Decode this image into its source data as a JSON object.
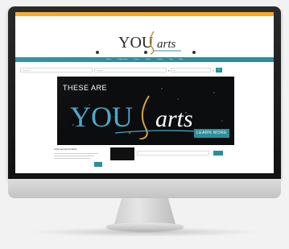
{
  "topbar": {
    "left": "",
    "right": "",
    "color": "#f6a623"
  },
  "logo": {
    "you": "YOU",
    "arts": "arts"
  },
  "nav": {
    "items": [
      "Home",
      "Creative Team",
      "Events",
      "Gallery",
      "Contact",
      "Shop",
      "Blog"
    ],
    "color": "#2a8f9a"
  },
  "search": {
    "field1": "Keywords",
    "field2": "Location",
    "field3": "All",
    "button": "Go"
  },
  "hero": {
    "top_text": "THESE ARE",
    "you": "YOU",
    "arts": "arts",
    "button": "LEARN MORE"
  },
  "lower": {
    "card_title": "4 Recommend Cards",
    "thumb_text": "",
    "card_btn": "",
    "go": ""
  }
}
